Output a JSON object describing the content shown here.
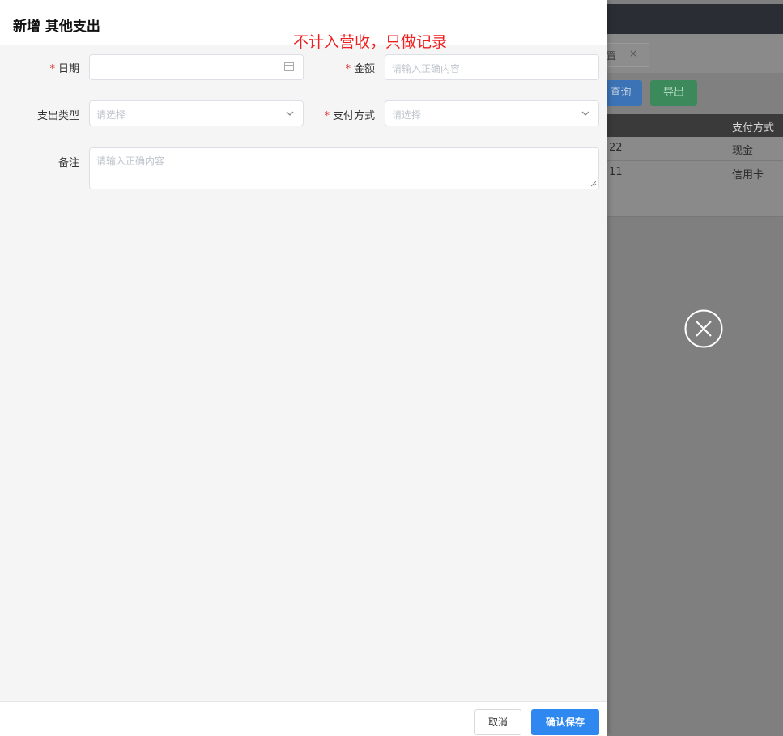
{
  "background": {
    "tab_label": "置",
    "tab_close": "×",
    "query_button": "查询",
    "export_button": "导出",
    "table_header_payment": "支付方式",
    "rows": [
      {
        "date_fragment": "22",
        "payment": "现金"
      },
      {
        "date_fragment": "11",
        "payment": "信用卡"
      }
    ]
  },
  "drawer": {
    "title": "新增 其他支出",
    "annotation": "不计入营收，只做记录",
    "required_mark": "*",
    "fields": {
      "date": {
        "label": "日期",
        "value": "",
        "placeholder": ""
      },
      "amount": {
        "label": "金额",
        "placeholder": "请输入正确内容"
      },
      "expense_type": {
        "label": "支出类型",
        "placeholder": "请选择"
      },
      "payment_method": {
        "label": "支付方式",
        "placeholder": "请选择"
      },
      "remark": {
        "label": "备注",
        "placeholder": "请输入正确内容"
      }
    },
    "footer": {
      "cancel": "取消",
      "save": "确认保存"
    }
  },
  "colors": {
    "primary": "#2f88f0",
    "required": "#e02c2c",
    "annotation": "#ee2020",
    "overlay": "#7f7f7f"
  }
}
